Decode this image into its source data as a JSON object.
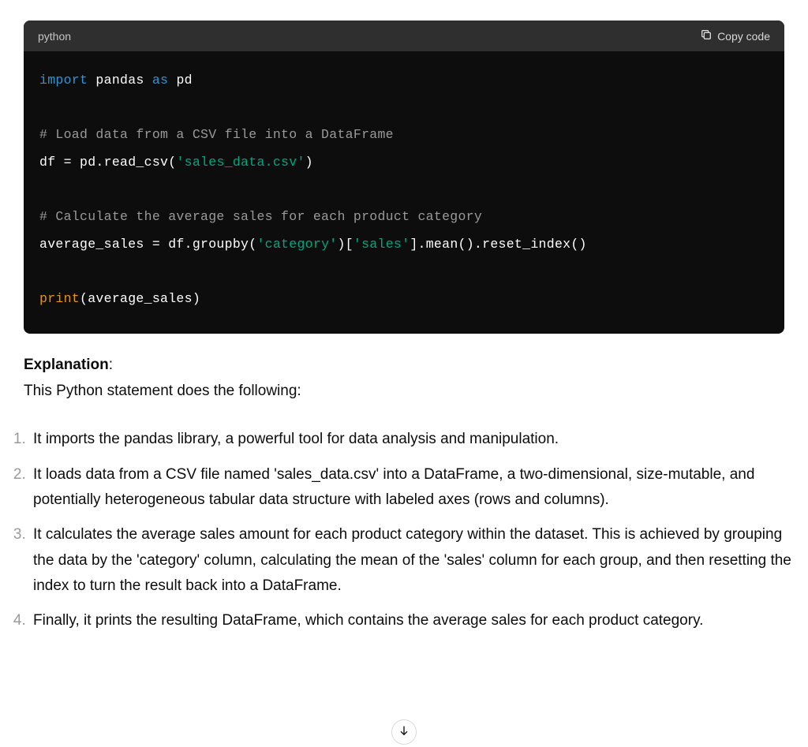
{
  "codeblock": {
    "language": "python",
    "copy_label": "Copy code",
    "line1_import": "import",
    "line1_pandas": " pandas ",
    "line1_as": "as",
    "line1_pd": " pd",
    "line3_comment": "# Load data from a CSV file into a DataFrame",
    "line4_a": "df = pd.read_csv(",
    "line4_str": "'sales_data.csv'",
    "line4_b": ")",
    "line6_comment": "# Calculate the average sales for each product category",
    "line7_a": "average_sales = df.groupby(",
    "line7_str1": "'category'",
    "line7_b": ")[",
    "line7_str2": "'sales'",
    "line7_c": "].mean().reset_index()",
    "line9_print": "print",
    "line9_rest": "(average_sales)"
  },
  "explanation": {
    "label": "Explanation",
    "colon": ":",
    "intro": "This Python statement does the following:",
    "items": [
      "It imports the pandas library, a powerful tool for data analysis and manipulation.",
      "It loads data from a CSV file named 'sales_data.csv' into a DataFrame, a two-dimensional, size-mutable, and potentially heterogeneous tabular data structure with labeled axes (rows and columns).",
      "It calculates the average sales amount for each product category within the dataset. This is achieved by grouping the data by the 'category' column, calculating the mean of the 'sales' column for each group, and then resetting the index to turn the result back into a DataFrame.",
      "Finally, it prints the resulting DataFrame, which contains the average sales for each product category."
    ]
  }
}
